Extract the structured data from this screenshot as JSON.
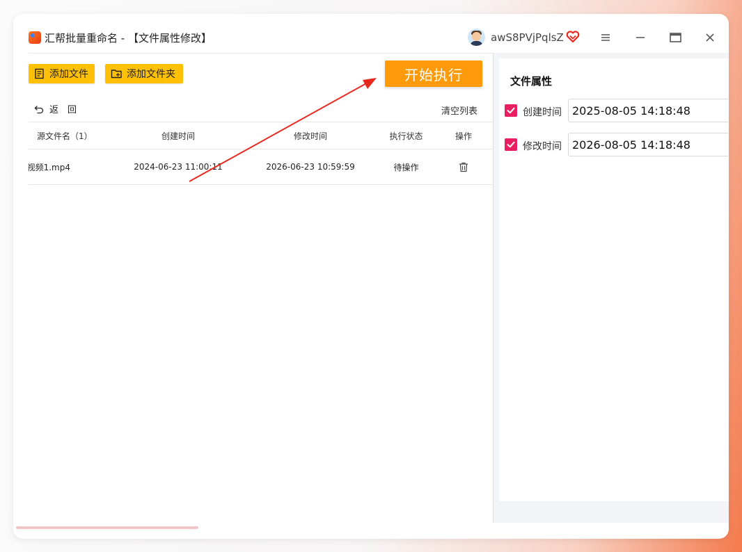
{
  "window": {
    "title": "汇帮批量重命名 - 【文件属性修改】",
    "username": "awS8PVjPqlsZ"
  },
  "toolbar": {
    "add_file_label": "添加文件",
    "add_folder_label": "添加文件夹",
    "start_label": "开始执行"
  },
  "list": {
    "back_label": "返　回",
    "clear_label": "清空列表",
    "headers": {
      "name": "源文件名（1）",
      "created": "创建时间",
      "modified": "修改时间",
      "status": "执行状态",
      "op": "操作"
    },
    "rows": [
      {
        "name": "视频1.mp4",
        "created": "2024-06-23 11:00:11",
        "modified": "2026-06-23 10:59:59",
        "status": "待操作"
      }
    ]
  },
  "props": {
    "title": "文件属性",
    "created_label": "创建时间",
    "created_value": "2025-08-05 14:18:48",
    "created_checked": true,
    "modified_label": "修改时间",
    "modified_value": "2026-08-05 14:18:48",
    "modified_checked": true
  },
  "colors": {
    "accent_yellow": "#ffc107",
    "start_orange": "#ff9b0a",
    "checkbox_pink": "#e91e63",
    "arrow_red": "#e8281e"
  },
  "icons": [
    "app-logo-icon",
    "avatar",
    "vip-heart-icon",
    "menu-icon",
    "minimize-icon",
    "maximize-icon",
    "close-icon",
    "add-file-icon",
    "add-folder-icon",
    "back-icon",
    "trash-icon",
    "check-icon"
  ]
}
